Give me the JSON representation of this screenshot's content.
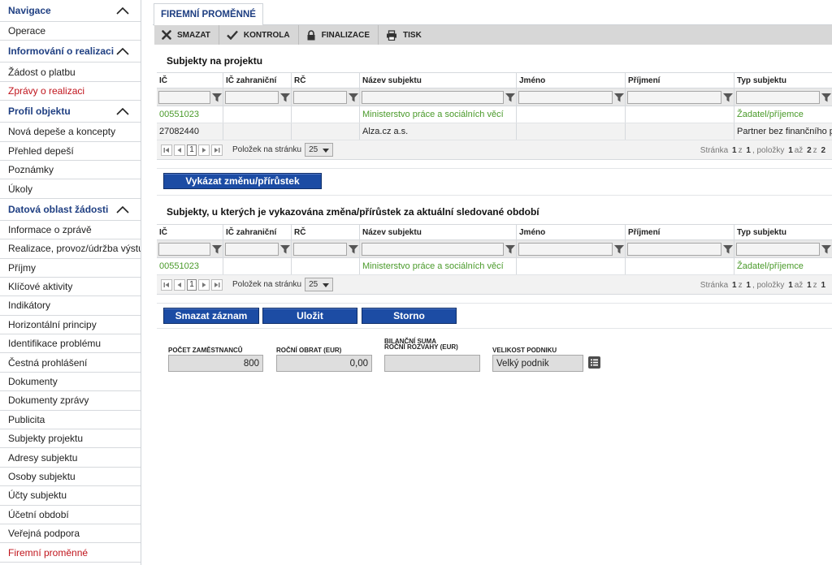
{
  "sidebar": {
    "sections": [
      {
        "title": "Navigace",
        "items": [
          "Operace"
        ]
      },
      {
        "title": "Informování o realizaci",
        "items": [
          "Žádost o platbu",
          "Zprávy o realizaci"
        ]
      },
      {
        "title": "Profil objektu",
        "items": [
          "Nová depeše a koncepty",
          "Přehled depeší",
          "Poznámky",
          "Úkoly"
        ]
      },
      {
        "title": "Datová oblast žádosti",
        "items": [
          "Informace o zprávě",
          "Realizace, provoz/údržba výstupu",
          "Příjmy",
          "Klíčové aktivity",
          "Indikátory",
          "Horizontální principy",
          "Identifikace problému",
          "Čestná prohlášení",
          "Dokumenty",
          "Dokumenty zprávy",
          "Publicita",
          "Subjekty projektu",
          "Adresy subjektu",
          "Osoby subjektu",
          "Účty subjektu",
          "Účetní období",
          "Veřejná podpora",
          "Firemní proměnné"
        ]
      }
    ]
  },
  "tab": {
    "label": "FIREMNÍ PROMĚNNÉ"
  },
  "toolbar": {
    "delete": "SMAZAT",
    "check": "KONTROLA",
    "finalize": "FINALIZACE",
    "print": "TISK"
  },
  "grid_columns": [
    "IČ",
    "IČ zahraniční",
    "RČ",
    "Název subjektu",
    "Jméno",
    "Příjmení",
    "Typ subjektu"
  ],
  "subjects": {
    "title": "Subjekty na projektu",
    "rows": [
      {
        "ic": "00551023",
        "ic_zahr": "",
        "rc": "",
        "nazev": "Ministerstvo práce a sociálních věcí",
        "jmeno": "",
        "prijmeni": "",
        "typ": "Žadatel/příjemce"
      },
      {
        "ic": "27082440",
        "ic_zahr": "",
        "rc": "",
        "nazev": "Alza.cz a.s.",
        "jmeno": "",
        "prijmeni": "",
        "typ": "Partner bez finančního p..."
      }
    ],
    "pager": {
      "page": "1",
      "per_page_label": "Položek na stránku",
      "per_page": "25",
      "info_prefix": "Stránka",
      "info_page": "1",
      "info_of": "z",
      "info_pages": "1",
      "info_items": ", položky",
      "info_from": "1",
      "info_to_word": "až",
      "info_to": "2",
      "info_of2": "z",
      "info_total": "2"
    }
  },
  "report_change_button": "Vykázat změnu/přírůstek",
  "changes": {
    "title": "Subjekty, u kterých je vykazována změna/přírůstek za aktuální sledované období",
    "rows": [
      {
        "ic": "00551023",
        "ic_zahr": "",
        "rc": "",
        "nazev": "Ministerstvo práce a sociálních věcí",
        "jmeno": "",
        "prijmeni": "",
        "typ": "Žadatel/příjemce"
      }
    ],
    "pager": {
      "page": "1",
      "per_page_label": "Položek na stránku",
      "per_page": "25",
      "info_prefix": "Stránka",
      "info_page": "1",
      "info_of": "z",
      "info_pages": "1",
      "info_items": ", položky",
      "info_from": "1",
      "info_to_word": "až",
      "info_to": "1",
      "info_of2": "z",
      "info_total": "1"
    }
  },
  "actions": {
    "delete": "Smazat záznam",
    "save": "Uložit",
    "cancel": "Storno"
  },
  "form": {
    "employees": {
      "label": "POČET ZAMĚSTNANCŮ",
      "value": "800"
    },
    "turnover": {
      "label": "ROČNÍ OBRAT (EUR)",
      "value": "0,00"
    },
    "balance": {
      "label_line1": "BILANČNÍ SUMA",
      "label_line2": "ROČNÍ ROZVAHY (EUR)",
      "value": ""
    },
    "size": {
      "label": "VELIKOST PODNIKU",
      "value": "Velký podnik"
    }
  }
}
